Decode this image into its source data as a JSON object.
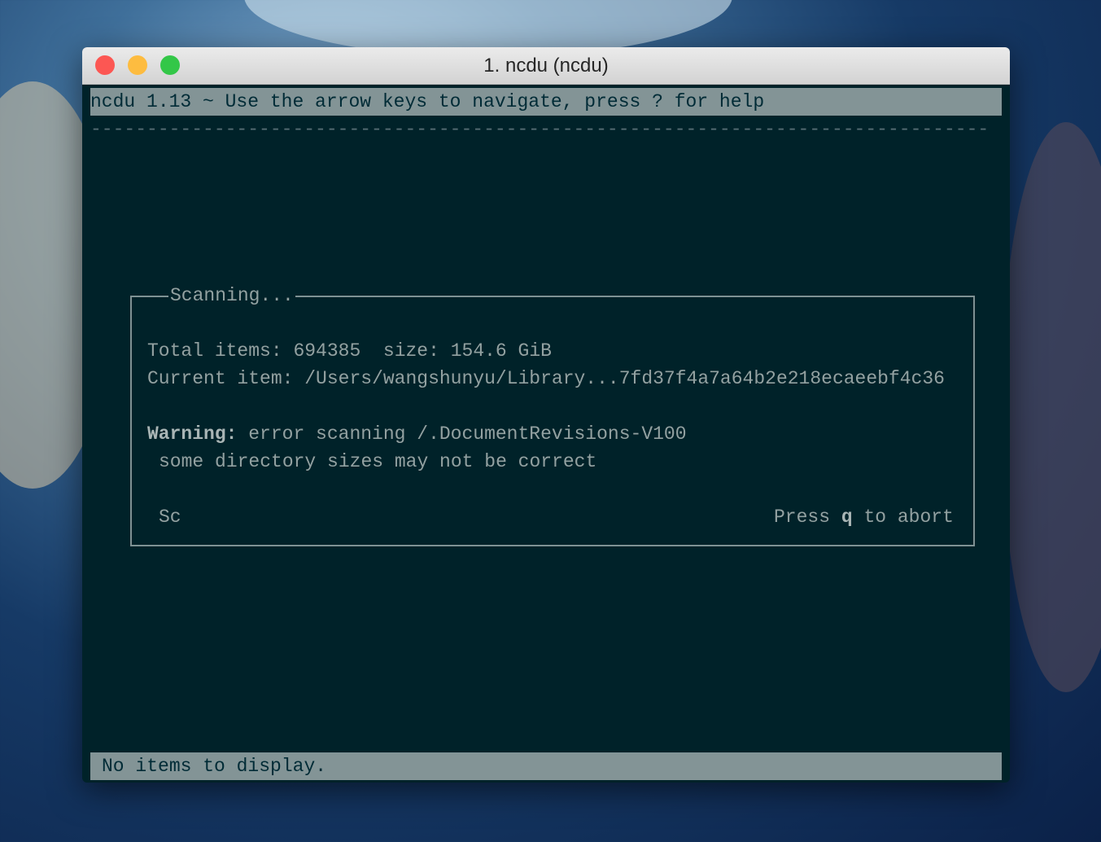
{
  "window": {
    "title": "1. ncdu (ncdu)",
    "colors": {
      "close": "#fc5753",
      "minimize": "#fdbc40",
      "zoom": "#33c748"
    }
  },
  "terminal": {
    "header": "ncdu 1.13 ~ Use the arrow keys to navigate, press ? for help",
    "separator": "--------------------------------------------------------------------------------",
    "dialog": {
      "title": "Scanning...",
      "total_items_label": "Total items:",
      "total_items": "694385",
      "size_label": "size:",
      "size": "154.6 GiB",
      "current_item_label": "Current item:",
      "current_item": "/Users/wangshunyu/Library...7fd37f4a7a64b2e218ecaeebf4c36",
      "warning_label": "Warning:",
      "warning_text": "error scanning /.DocumentRevisions-V100",
      "warning_detail": "some directory sizes may not be correct",
      "spinner": "Sc",
      "abort_press": "Press",
      "abort_key": "q",
      "abort_rest": "to abort"
    },
    "status": "No items to display."
  }
}
